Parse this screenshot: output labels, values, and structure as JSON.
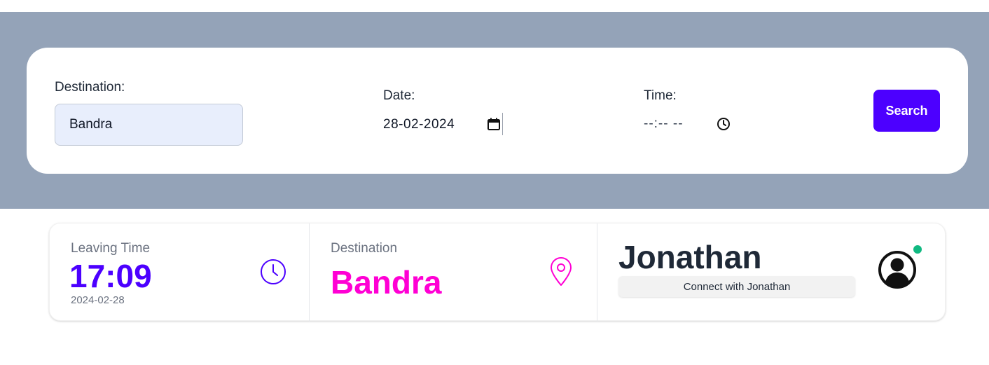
{
  "search": {
    "destination_label": "Destination:",
    "destination_value": "Bandra",
    "date_label": "Date:",
    "date_value": "28-02-2024",
    "time_label": "Time:",
    "time_value": "--:-- --",
    "search_label": "Search"
  },
  "stats": {
    "leaving": {
      "title": "Leaving Time",
      "value": "17:09",
      "desc": "2024-02-28",
      "icon": "clock-icon"
    },
    "destination": {
      "title": "Destination",
      "value": "Bandra",
      "icon": "map-pin-icon"
    },
    "user": {
      "name": "Jonathan",
      "connect_label": "Connect with Jonathan",
      "icon": "user-avatar-icon",
      "status": "online"
    }
  },
  "colors": {
    "accent": "#4c00ff",
    "destination": "#ff00d4",
    "online": "#10b981",
    "header_bg": "#94a3b8"
  }
}
